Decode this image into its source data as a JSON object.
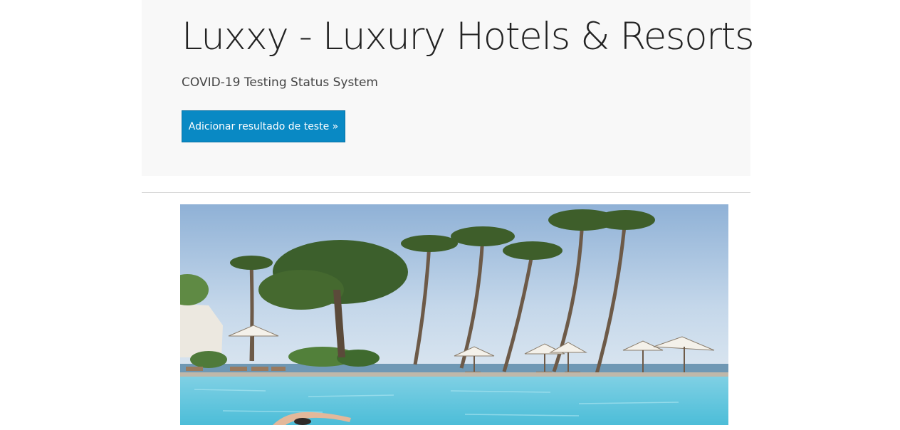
{
  "header": {
    "title": "Luxxy - Luxury Hotels & Resorts",
    "subtitle": "COVID-19 Testing Status System",
    "add_result_button": "Adicionar resultado de teste »"
  },
  "hero_image": {
    "description_icon": "resort-pool-photo"
  },
  "colors": {
    "accent": "#0989c4",
    "jumbotron_bg": "#f8f8f8",
    "text": "#222222"
  }
}
